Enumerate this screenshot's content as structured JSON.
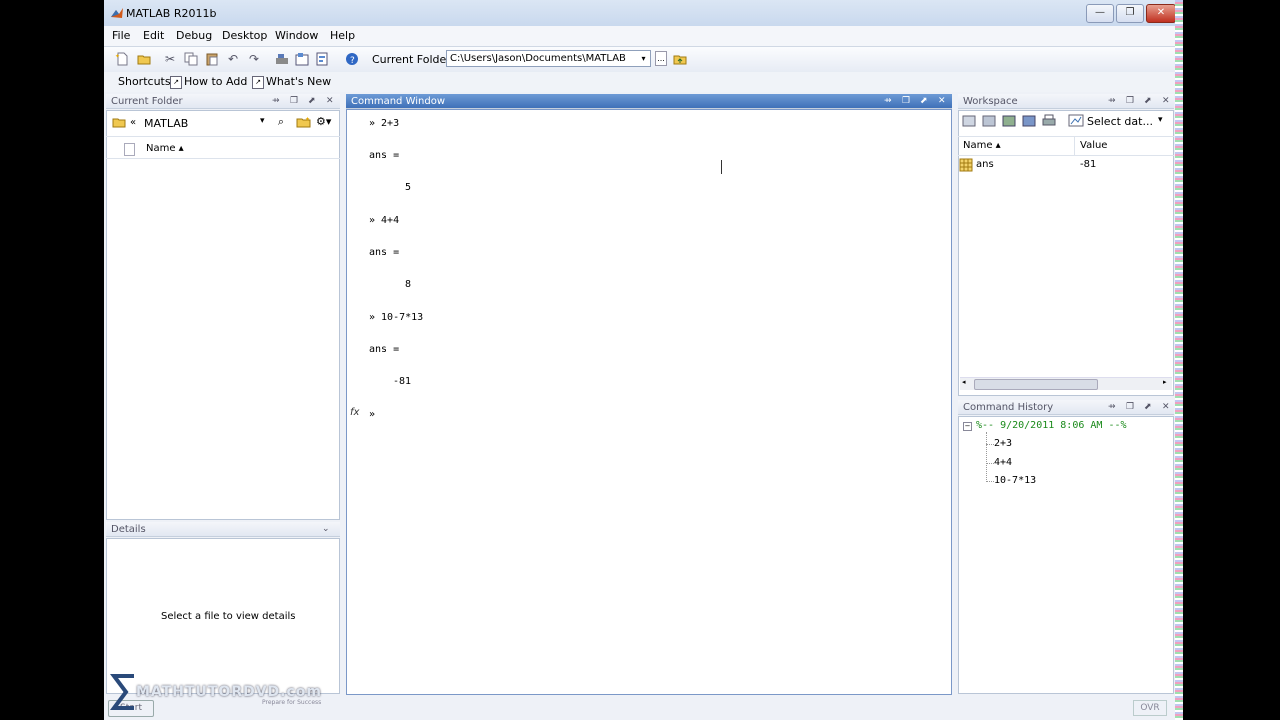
{
  "window": {
    "title": "MATLAB  R2011b",
    "min": "—",
    "max": "❐",
    "close": "✕"
  },
  "menu": [
    "File",
    "Edit",
    "Debug",
    "Desktop",
    "Window",
    "Help"
  ],
  "toolbar": {
    "current_folder_label": "Current Folder:",
    "current_folder_value": "C:\\Users\\Jason\\Documents\\MATLAB",
    "browse": "...",
    "dropdown": "▾"
  },
  "shortcuts": {
    "shortcuts": "Shortcuts",
    "how_to_add": "How to Add",
    "whats_new": "What's New"
  },
  "current_folder": {
    "title": "Current Folder",
    "path": "MATLAB",
    "path_prefix": "«",
    "name_column": "Name ▴",
    "details_title": "Details",
    "details_message": "Select a file to view details"
  },
  "command_window": {
    "title": "Command Window",
    "lines": [
      "» 2+3",
      "ans =",
      "5",
      "» 4+4",
      "ans =",
      "8",
      "» 10-7*13",
      "ans =",
      "-81",
      "»"
    ],
    "fx": "fx"
  },
  "workspace": {
    "title": "Workspace",
    "select_data": "Select dat...",
    "col_name": "Name ▴",
    "col_value": "Value",
    "variables": [
      {
        "name": "ans",
        "value": "-81"
      }
    ]
  },
  "command_history": {
    "title": "Command History",
    "session": "%-- 9/20/2011 8:06 AM --%",
    "entries": [
      "2+3",
      "4+4",
      "10-7*13"
    ]
  },
  "watermark": {
    "brand": "MATHTUTORDVD.com",
    "tagline": "Prepare for Success"
  },
  "status": {
    "start": "Start",
    "ovr": "OVR"
  },
  "colors": {
    "active_header": "#3f70b8",
    "history_green": "#1a8a1a"
  }
}
